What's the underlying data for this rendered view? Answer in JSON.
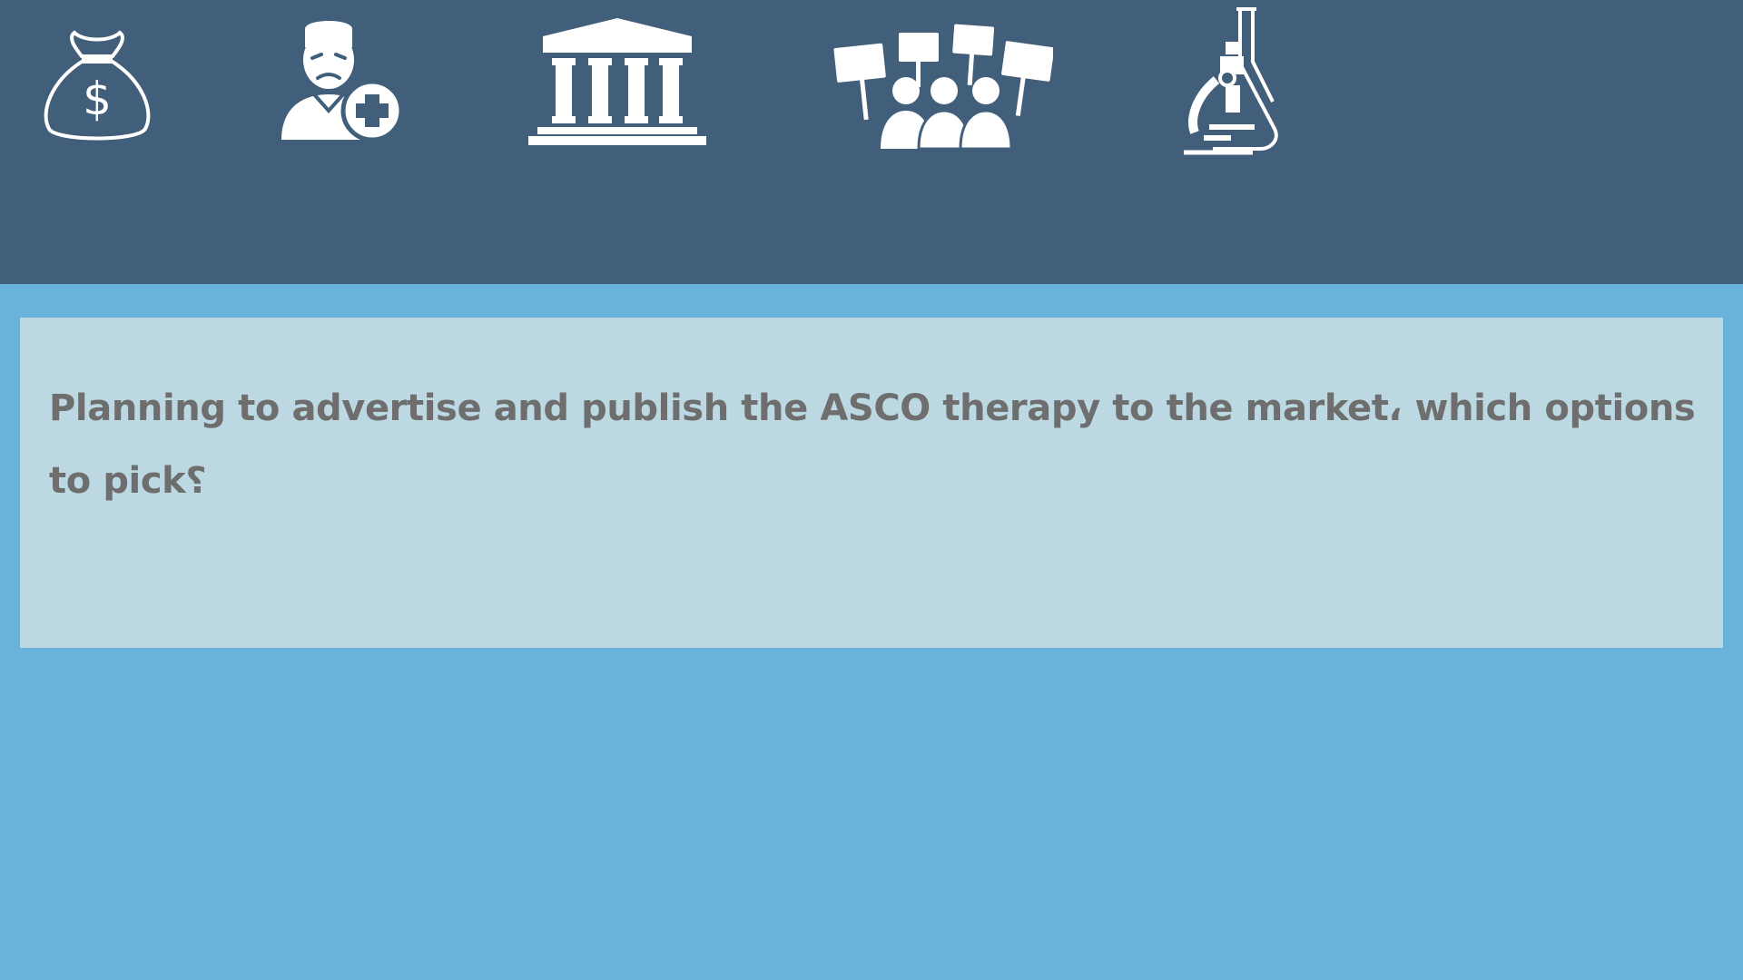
{
  "header": {
    "icons": [
      {
        "name": "money-bag-icon"
      },
      {
        "name": "patient-icon"
      },
      {
        "name": "government-building-icon"
      },
      {
        "name": "protest-crowd-icon"
      },
      {
        "name": "laboratory-icon"
      }
    ],
    "background_color": "#415e7a"
  },
  "question": {
    "text": "Planning to advertise and publish the ASCO therapy to the market، which options to pick؟",
    "panel_color": "#bcd9e3",
    "text_color": "#6e6e6e"
  },
  "page": {
    "background_color": "#67b3da"
  }
}
